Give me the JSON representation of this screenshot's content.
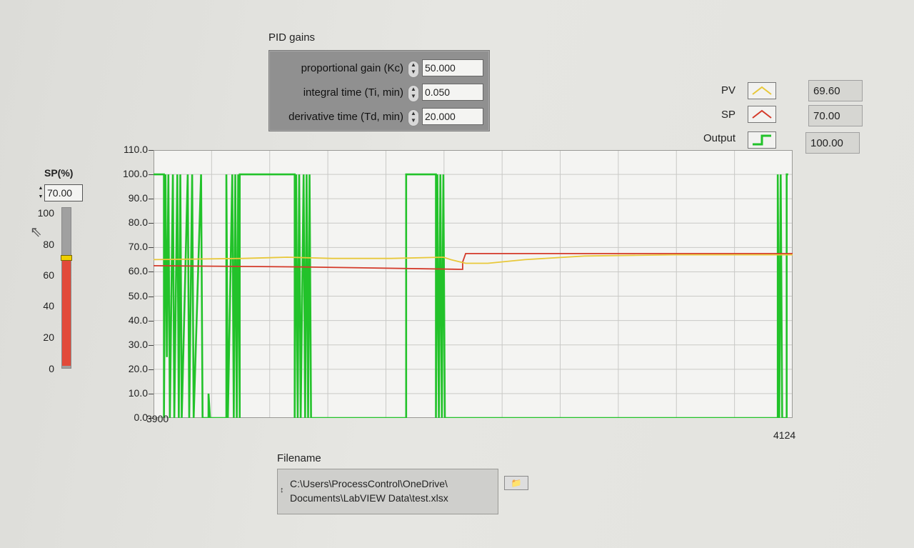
{
  "pid": {
    "title": "PID gains",
    "rows": [
      {
        "label": "proportional gain (Kc)",
        "value": "50.000"
      },
      {
        "label": "integral time (Ti, min)",
        "value": "0.050"
      },
      {
        "label": "derivative time (Td, min)",
        "value": "20.000"
      }
    ]
  },
  "legend": {
    "items": [
      {
        "name": "PV",
        "value": "69.60",
        "color": "#e8c83a"
      },
      {
        "name": "SP",
        "value": "70.00",
        "color": "#d43a2a"
      },
      {
        "name": "Output",
        "value": "100.00",
        "color": "#22c22a"
      }
    ]
  },
  "setpoint": {
    "title": "SP(%)",
    "value": "70.00",
    "level_percent": 70,
    "ticks": [
      "100",
      "80",
      "60",
      "40",
      "20",
      "0"
    ]
  },
  "filename": {
    "title": "Filename",
    "line1": "C:\\Users\\ProcessControl\\OneDrive\\",
    "line2": "Documents\\LabVIEW Data\\test.xlsx",
    "browse_icon": "folder-icon"
  },
  "chart_data": {
    "type": "line",
    "x_range": [
      3900,
      4124
    ],
    "x_ticks": [
      "3900",
      "4124"
    ],
    "y_range": [
      0,
      110
    ],
    "y_ticks": [
      "110.0",
      "100.0",
      "90.0",
      "80.0",
      "70.0",
      "60.0",
      "50.0",
      "40.0",
      "30.0",
      "20.0",
      "10.0",
      "0.0"
    ],
    "grid": true,
    "series": [
      {
        "name": "PV",
        "color": "#e8c83a",
        "points": [
          [
            3900,
            65
          ],
          [
            3960,
            65.5
          ],
          [
            3990,
            66
          ],
          [
            4020,
            65.5
          ],
          [
            4060,
            65.5
          ],
          [
            4095,
            66
          ],
          [
            4100,
            65
          ],
          [
            4110,
            63.5
          ],
          [
            4125,
            63.5
          ],
          [
            4150,
            65
          ],
          [
            4190,
            66.5
          ],
          [
            4250,
            67
          ],
          [
            4330,
            67
          ]
        ]
      },
      {
        "name": "SP",
        "color": "#d43a2a",
        "points": [
          [
            3900,
            62.5
          ],
          [
            4000,
            62
          ],
          [
            4108,
            61
          ],
          [
            4108,
            64
          ],
          [
            4110,
            67.5
          ],
          [
            4200,
            67.5
          ],
          [
            4330,
            67.5
          ]
        ]
      },
      {
        "name": "Output",
        "color": "#22c22a",
        "points": [
          [
            3900,
            100
          ],
          [
            3907,
            100
          ],
          [
            3907,
            0
          ],
          [
            3908,
            100
          ],
          [
            3909,
            25
          ],
          [
            3910,
            100
          ],
          [
            3911,
            0
          ],
          [
            3913,
            100
          ],
          [
            3914,
            0
          ],
          [
            3916,
            100
          ],
          [
            3917,
            0
          ],
          [
            3918,
            100
          ],
          [
            3919,
            0
          ],
          [
            3923,
            100
          ],
          [
            3924,
            0
          ],
          [
            3926,
            100
          ],
          [
            3927,
            0
          ],
          [
            3932,
            100
          ],
          [
            3933,
            0
          ],
          [
            3937,
            0
          ],
          [
            3937,
            10
          ],
          [
            3938,
            0
          ],
          [
            3949,
            0
          ],
          [
            3949,
            100
          ],
          [
            3950,
            0
          ],
          [
            3953,
            100
          ],
          [
            3954,
            0
          ],
          [
            3955,
            100
          ],
          [
            3956,
            0
          ],
          [
            3957,
            100
          ],
          [
            3958,
            0
          ],
          [
            3958,
            100
          ],
          [
            3970,
            100
          ],
          [
            3995,
            100
          ],
          [
            3995,
            0
          ],
          [
            3996,
            100
          ],
          [
            3997,
            0
          ],
          [
            3998,
            100
          ],
          [
            3999,
            0
          ],
          [
            4001,
            100
          ],
          [
            4002,
            0
          ],
          [
            4003,
            100
          ],
          [
            4004,
            0
          ],
          [
            4005,
            100
          ],
          [
            4006,
            0
          ],
          [
            4055,
            0
          ],
          [
            4070,
            0
          ],
          [
            4070,
            100
          ],
          [
            4075,
            100
          ],
          [
            4090,
            100
          ],
          [
            4090,
            0
          ],
          [
            4091,
            100
          ],
          [
            4092,
            0
          ],
          [
            4093,
            100
          ],
          [
            4094,
            0
          ],
          [
            4095,
            100
          ],
          [
            4096,
            0
          ],
          [
            4150,
            0
          ],
          [
            4200,
            0
          ],
          [
            4250,
            0
          ],
          [
            4320,
            0
          ],
          [
            4320,
            100
          ],
          [
            4321,
            0
          ],
          [
            4322,
            100
          ],
          [
            4323,
            0
          ],
          [
            4326,
            0
          ],
          [
            4326,
            100
          ],
          [
            4327,
            100
          ]
        ]
      }
    ]
  }
}
